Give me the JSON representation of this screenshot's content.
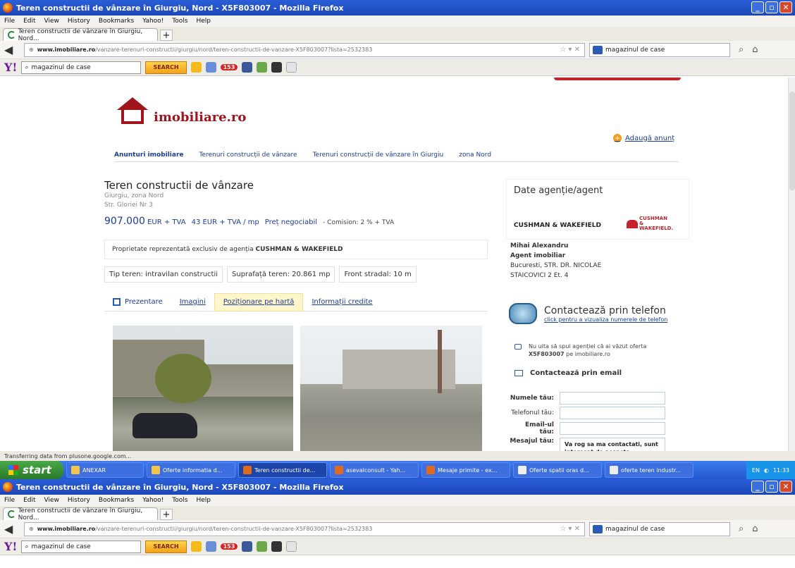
{
  "window": {
    "title": "Teren constructii de vânzare în Giurgiu, Nord - X5F803007 - Mozilla Firefox"
  },
  "menu": [
    "File",
    "Edit",
    "View",
    "History",
    "Bookmarks",
    "Yahoo!",
    "Tools",
    "Help"
  ],
  "tab": {
    "label": "Teren constructii de vânzare în Giurgiu, Nord...",
    "new": "+"
  },
  "url": {
    "domain": "www.imobiliare.ro",
    "path": "/vanzare-terenuri-constructii/giurgiu/nord/teren-constructii-de-vanzare-X5F803007?lista=2532383"
  },
  "search": {
    "value": "magazinul de case"
  },
  "yahoo": {
    "logo": "Y!",
    "search_value": "magazinul de case",
    "search_button": "SEARCH",
    "badge": "153"
  },
  "site": {
    "logo": "imobiliare.ro",
    "add_listing": "Adaugă anunț",
    "crumbs": [
      "Anunturi imobiliare",
      "Terenuri construcții de vânzare",
      "Terenuri construcții de vânzare în Giurgiu",
      "zona Nord"
    ]
  },
  "listing": {
    "title": "Teren constructii de vânzare",
    "location": "Giurgiu, zona Nord",
    "street": "Str. Gloriei Nr 3",
    "price": "907.000",
    "price_unit": "EUR + TVA",
    "price_per_mp": "43 EUR + TVA / mp",
    "negotiable": "Preț negociabil",
    "commission": "- Comision: 2 % + TVA",
    "exclusive_prefix": "Proprietate reprezentată exclusiv de agenția",
    "exclusive_agency": "CUSHMAN & WAKEFIELD",
    "specs": [
      "Tip teren: intravilan constructii",
      "Suprafață teren: 20.861 mp",
      "Front stradal: 10 m"
    ],
    "tabs": [
      "Prezentare",
      "Imagini",
      "Poziționare pe hartă",
      "Informații credite"
    ]
  },
  "agency": {
    "heading": "Date agenție/agent",
    "name": "CUSHMAN & WAKEFIELD",
    "logo_text": "CUSHMAN & WAKEFIELD.",
    "agent_name": "Mihai Alexandru",
    "agent_role": "Agent imobiliar",
    "address1": "Bucuresti, STR. DR. NICOLAE",
    "address2": "STAICOVICI 2 Et. 4"
  },
  "contact": {
    "phone_title": "Contactează prin telefon",
    "phone_link": "click pentru a vizualiza numerele de telefon",
    "note1": "Nu uita să spui agenției că ai văzut oferta",
    "note2_code": "X5F803007",
    "note2_rest": "pe imobiliare.ro",
    "email_title": "Contactează prin email",
    "f_name": "Numele tău:",
    "f_phone": "Telefonul tău:",
    "f_email": "Email-ul tău:",
    "f_msg": "Mesajul tău:",
    "msg_value": "Va rog sa ma contactati, sunt interesat de aceasta proprietate."
  },
  "status": "Transferring data from plusone.google.com...",
  "taskbar": {
    "start": "start",
    "items": [
      "ANEXAR",
      "Oferte informatia d...",
      "Teren constructii de...",
      "asevalconsult - Yah...",
      "Mesaje primite - ex...",
      "Oferte spatii oras d...",
      "oferte teren industr..."
    ],
    "lang": "EN",
    "time": "11:33"
  }
}
